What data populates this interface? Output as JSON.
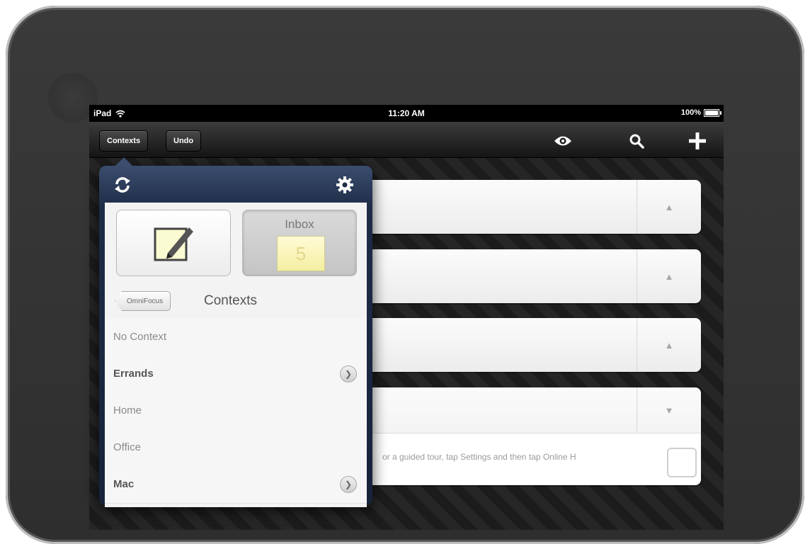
{
  "status": {
    "device": "iPad",
    "time": "11:20 AM",
    "battery": "100%"
  },
  "toolbar": {
    "contexts_label": "Contexts",
    "undo_label": "Undo"
  },
  "groups": [
    {
      "toggle": "▲"
    },
    {
      "toggle": "▲"
    },
    {
      "toggle": "▲"
    },
    {
      "toggle": "▼",
      "task_text": "or a guided tour, tap Settings and then tap Online H"
    }
  ],
  "popover": {
    "inbox_label": "Inbox",
    "inbox_count": "5",
    "back_label": "OmniFocus",
    "title": "Contexts",
    "contexts": [
      {
        "label": "No Context",
        "has_children": false,
        "bold": false
      },
      {
        "label": "Errands",
        "has_children": true,
        "bold": true
      },
      {
        "label": "Home",
        "has_children": false,
        "bold": false
      },
      {
        "label": "Office",
        "has_children": false,
        "bold": false
      },
      {
        "label": "Mac",
        "has_children": true,
        "bold": true
      }
    ]
  },
  "icons": [
    "wifi-icon",
    "battery-icon",
    "eye-icon",
    "search-icon",
    "plus-icon",
    "sync-icon",
    "gear-icon",
    "new-entry-icon",
    "chevron-right-icon"
  ]
}
